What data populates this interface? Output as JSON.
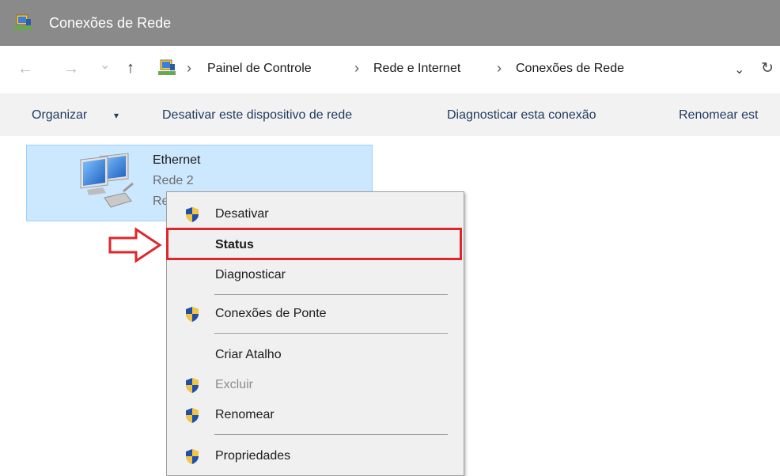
{
  "window": {
    "title": "Conexões de Rede"
  },
  "address": {
    "nav_back": "←",
    "nav_forward": "→",
    "nav_dropdown": "⌄",
    "nav_up": "↑",
    "separator": "›",
    "crumbs": [
      "Painel de Controle",
      "Rede e Internet",
      "Conexões de Rede"
    ],
    "dropdown": "⌄",
    "refresh": "↻"
  },
  "toolbar": {
    "organize": "Organizar",
    "organize_arrow": "▾",
    "disable_device": "Desativar este dispositivo de rede",
    "diagnose": "Diagnosticar esta conexão",
    "rename": "Renomear est"
  },
  "connection": {
    "name": "Ethernet",
    "network": "Rede  2",
    "status_partial": "Re"
  },
  "context_menu": {
    "items": [
      {
        "label": "Desativar",
        "shield": true,
        "enabled": true,
        "bold": false
      },
      {
        "label": "Status",
        "shield": false,
        "enabled": true,
        "bold": true
      },
      {
        "label": "Diagnosticar",
        "shield": false,
        "enabled": true,
        "bold": false
      },
      {
        "label": "Conexões de Ponte",
        "shield": true,
        "enabled": true,
        "bold": false
      },
      {
        "label": "Criar Atalho",
        "shield": false,
        "enabled": true,
        "bold": false
      },
      {
        "label": "Excluir",
        "shield": true,
        "enabled": false,
        "bold": false
      },
      {
        "label": "Renomear",
        "shield": true,
        "enabled": true,
        "bold": false
      },
      {
        "label": "Propriedades",
        "shield": true,
        "enabled": true,
        "bold": false
      }
    ]
  },
  "colors": {
    "titlebar": "#8a8a8a",
    "selection": "#cce8ff",
    "highlight_box": "#e0262b",
    "menu_bg": "#f0f0f0"
  }
}
